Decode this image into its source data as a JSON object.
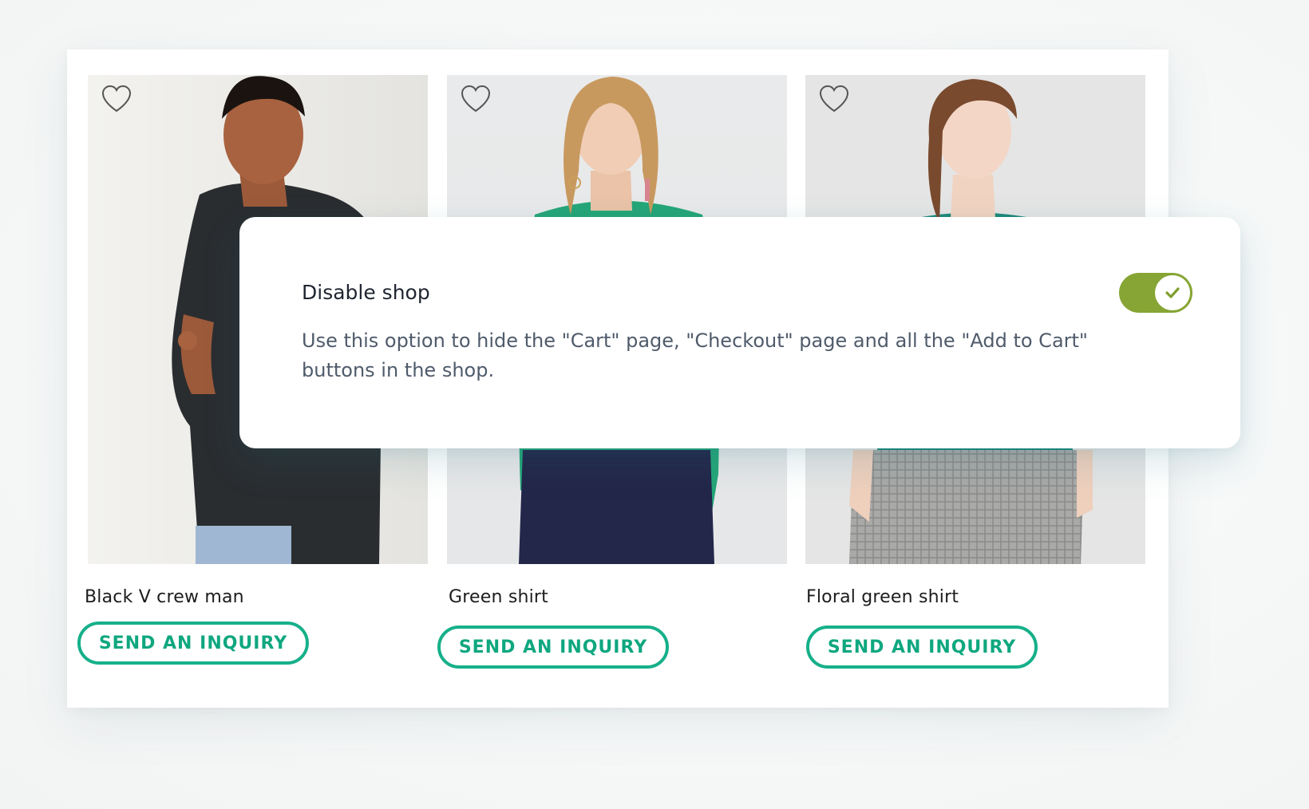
{
  "products": [
    {
      "name": "Black V crew man",
      "button_label": "SEND AN INQUIRY",
      "favorite_icon": "heart-outline-icon"
    },
    {
      "name": "Green shirt",
      "button_label": "SEND AN INQUIRY",
      "favorite_icon": "heart-outline-icon"
    },
    {
      "name": "Floral green shirt",
      "button_label": "SEND AN INQUIRY",
      "favorite_icon": "heart-outline-icon"
    }
  ],
  "setting": {
    "title": "Disable shop",
    "description": "Use this option to hide the \"Cart\" page, \"Checkout\" page and all the \"Add to Cart\" buttons in the shop.",
    "enabled": true,
    "toggle_icon": "check-icon"
  },
  "colors": {
    "accent_green": "#16b08a",
    "toggle_on": "#86a534",
    "text_dark": "#1f2530",
    "text_muted": "#4f5b6b"
  }
}
